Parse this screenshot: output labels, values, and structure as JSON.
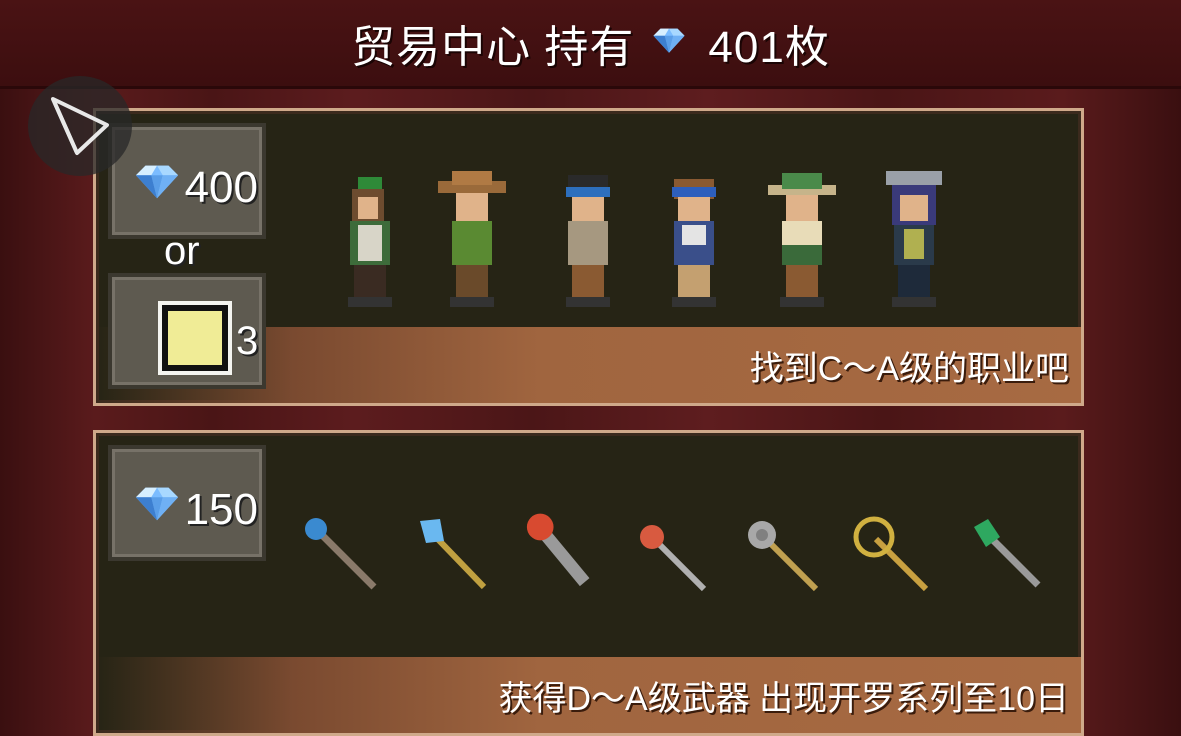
{
  "header": {
    "title": "贸易中心 持有",
    "amount": "401枚",
    "gem_icon": "diamond-icon"
  },
  "colors": {
    "background": "#4e1718",
    "panel": "#262415",
    "panel_border": "#cfa98a",
    "banner": "#a0653f",
    "gem": "#9fd0ff"
  },
  "panels": [
    {
      "price": "400",
      "or_label": "or",
      "ticket_count": "3",
      "banner_text": "找到C～A级的职业吧",
      "items": [
        "character-sprite-1",
        "character-sprite-2",
        "character-sprite-3",
        "character-sprite-4",
        "character-sprite-5",
        "character-sprite-6"
      ]
    },
    {
      "price": "150",
      "banner_text": "获得D～A级武器 出现开罗系列至10日",
      "items": [
        "blue-orb-staff",
        "ice-crystal-staff",
        "red-mace",
        "red-orb-rod",
        "spiked-mace",
        "gold-ring-staff",
        "green-gem-staff"
      ]
    }
  ]
}
